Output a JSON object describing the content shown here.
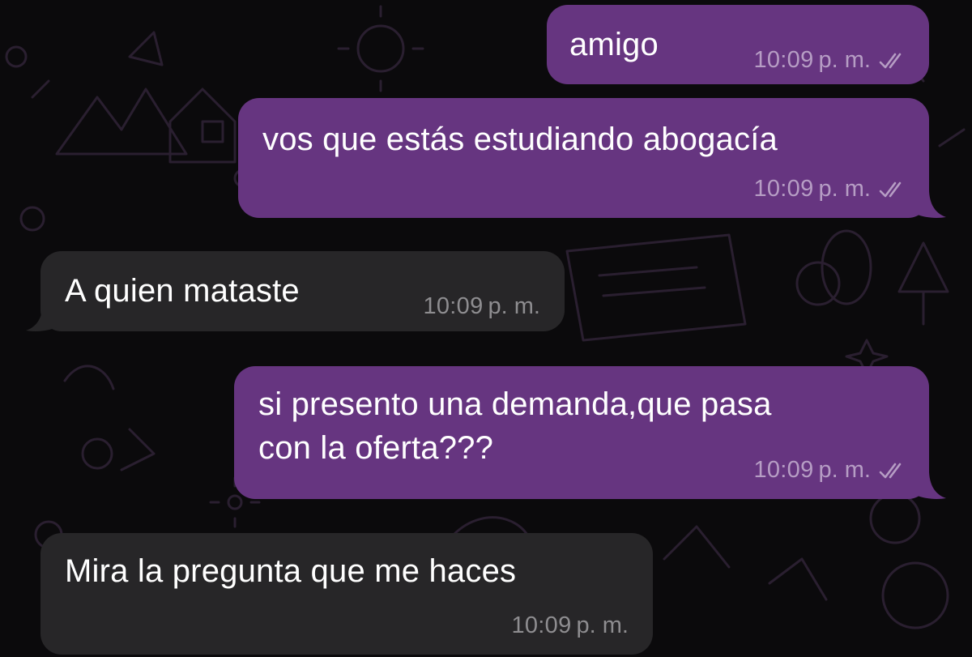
{
  "conversation": {
    "messages": [
      {
        "direction": "outgoing",
        "lines": [
          "amigo"
        ],
        "time": "10:09",
        "suffix": "p. m.",
        "status_icon": "double-check-read-icon"
      },
      {
        "direction": "outgoing",
        "lines": [
          "vos que estás estudiando abogacía"
        ],
        "time": "10:09",
        "suffix": "p. m.",
        "status_icon": "double-check-read-icon"
      },
      {
        "direction": "incoming",
        "lines": [
          "A quien mataste"
        ],
        "time": "10:09",
        "suffix": "p. m."
      },
      {
        "direction": "outgoing",
        "lines": [
          "si presento una demanda,que pasa",
          "con la oferta???"
        ],
        "time": "10:09",
        "suffix": "p. m.",
        "status_icon": "double-check-read-icon"
      },
      {
        "direction": "incoming",
        "lines": [
          "Mira la pregunta que me haces"
        ],
        "time": "10:09",
        "suffix": "p. m."
      }
    ]
  },
  "colors": {
    "outgoing_bubble": "#663580",
    "incoming_bubble": "#272628",
    "background": "#0b0a0c",
    "wallpaper_doodle": "#2a1f30"
  }
}
